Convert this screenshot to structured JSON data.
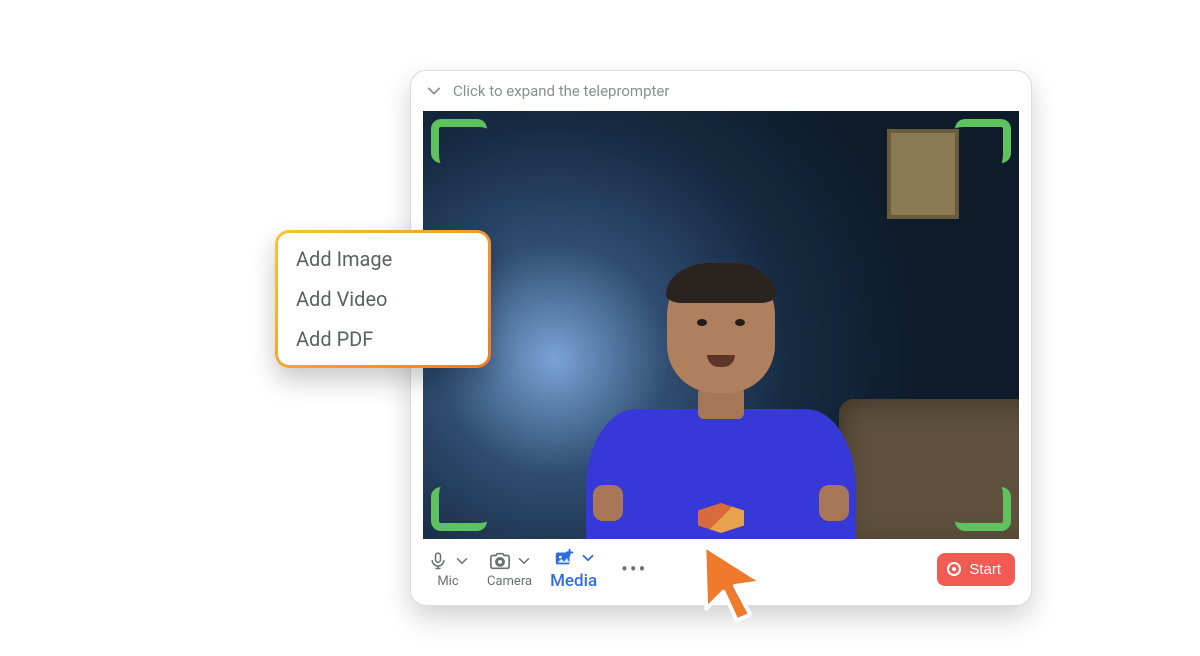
{
  "teleprompter": {
    "placeholder": "Click to expand the teleprompter"
  },
  "toolbar": {
    "mic_label": "Mic",
    "camera_label": "Camera",
    "media_label": "Media",
    "start_label": "Start"
  },
  "media_menu": {
    "items": [
      {
        "label": "Add Image"
      },
      {
        "label": "Add Video"
      },
      {
        "label": "Add PDF"
      }
    ]
  },
  "colors": {
    "accent_blue": "#2f6de0",
    "start_red": "#f15b54",
    "frame_green": "#5ec25e",
    "gradient_start": "#f7c531",
    "gradient_end": "#f07a2c"
  }
}
